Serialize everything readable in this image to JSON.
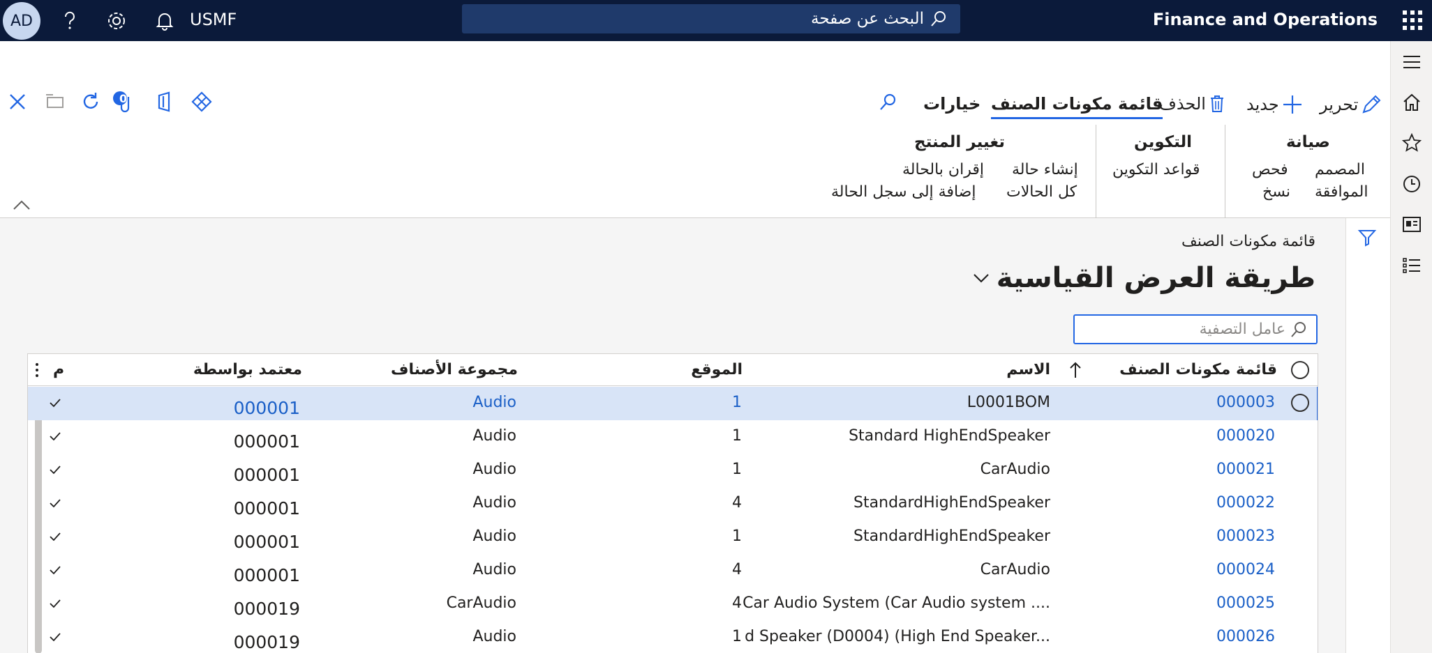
{
  "topbar": {
    "avatar": "AD",
    "company": "USMF",
    "search_placeholder": "البحث عن صفحة",
    "app_title": "Finance and Operations"
  },
  "actionpane": {
    "edit": "تحرير",
    "new": "جديد",
    "delete": "الحذف",
    "tab_bom": "قائمة مكونات الصنف",
    "tab_options": "خيارات",
    "attachments_count": "0",
    "groups": {
      "maintain": {
        "title": "صيانة",
        "items": [
          "المصمم",
          "فحص",
          "الموافقة",
          "نسخ"
        ]
      },
      "config": {
        "title": "التكوين",
        "items": [
          "قواعد التكوين"
        ]
      },
      "product_change": {
        "title": "تغيير المنتج",
        "items": [
          "إنشاء حالة",
          "إقران بالحالة",
          "كل الحالات",
          "إضافة إلى سجل الحالة"
        ]
      }
    }
  },
  "page": {
    "breadcrumb": "قائمة مكونات الصنف",
    "title": "طريقة العرض القياسية",
    "filter_placeholder": "عامل التصفية"
  },
  "grid": {
    "headers": {
      "bom": "قائمة مكونات الصنف",
      "name": "الاسم",
      "site": "الموقع",
      "item_group": "مجموعة الأصناف",
      "approved_by": "معتمد بواسطة",
      "approved": "م"
    },
    "rows": [
      {
        "bom": "000003",
        "name": "L0001BOM",
        "site": "1",
        "group": "Audio",
        "approver": "000001",
        "selected": true
      },
      {
        "bom": "000020",
        "name": "Standard HighEndSpeaker",
        "site": "1",
        "group": "Audio",
        "approver": "000001"
      },
      {
        "bom": "000021",
        "name": "CarAudio",
        "site": "1",
        "group": "Audio",
        "approver": "000001"
      },
      {
        "bom": "000022",
        "name": "StandardHighEndSpeaker",
        "site": "4",
        "group": "Audio",
        "approver": "000001"
      },
      {
        "bom": "000023",
        "name": "StandardHighEndSpeaker",
        "site": "1",
        "group": "Audio",
        "approver": "000001"
      },
      {
        "bom": "000024",
        "name": "CarAudio",
        "site": "4",
        "group": "Audio",
        "approver": "000001"
      },
      {
        "bom": "000025",
        "name": "Car Audio System (Car Audio system ....",
        "site": "4",
        "group": "CarAudio",
        "approver": "000019"
      },
      {
        "bom": "000026",
        "name": "d Speaker (D0004) (High End Speaker...",
        "site": "1",
        "group": "Audio",
        "approver": "000019"
      }
    ]
  },
  "colors": {
    "nav_bg": "#0b1a3a",
    "accent": "#2266e3",
    "link": "#1a5fc7",
    "selected_row": "#d8e4f7"
  }
}
